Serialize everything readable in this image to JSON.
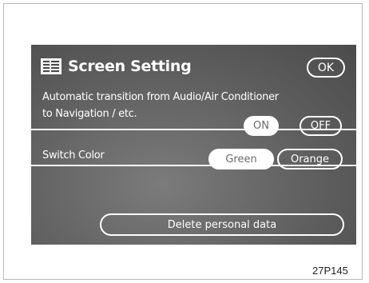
{
  "screen": {
    "title": "Screen Setting",
    "ok_label": "OK",
    "description_lines": [
      "Automatic transition from Audio/Air Conditioner",
      "to Navigation / etc."
    ],
    "transition_options": {
      "on_label": "ON",
      "off_label": "OFF",
      "selected": "ON"
    },
    "switch_color": {
      "label": "Switch Color",
      "green_label": "Green",
      "orange_label": "Orange",
      "selected": "Green"
    },
    "delete_label": "Delete personal data",
    "icon": "screen-settings-icon"
  },
  "caption": "27P145",
  "colors": {
    "screen_bg": "#5f5f5f",
    "text": "#ffffff",
    "selected_button_text": "#6b6b6b"
  }
}
